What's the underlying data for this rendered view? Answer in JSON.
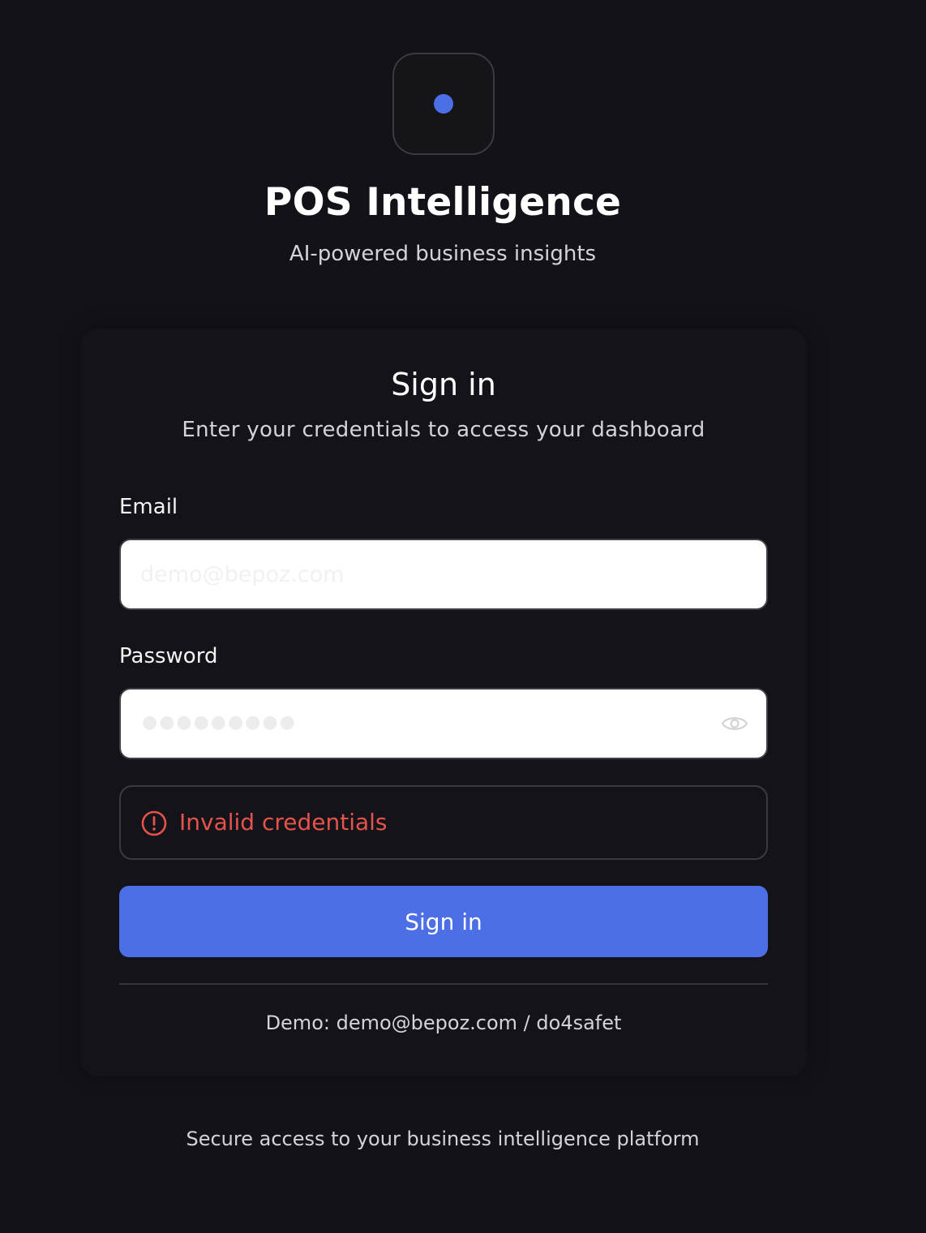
{
  "brand": {
    "title": "POS Intelligence",
    "subtitle": "AI-powered business insights",
    "logo_icon": "dot-logo-icon",
    "accent_color": "#4d6fe6"
  },
  "card": {
    "title": "Sign in",
    "subtitle": "Enter your credentials to access your dashboard",
    "email": {
      "label": "Email",
      "placeholder": "demo@bepoz.com",
      "value": ""
    },
    "password": {
      "label": "Password",
      "placeholder_dots": "●●●●●●●●●",
      "value": "",
      "toggle_icon": "eye-icon"
    },
    "error": {
      "icon": "alert-circle-icon",
      "message": "Invalid credentials",
      "color": "#e5534b"
    },
    "submit_label": "Sign in",
    "demo_hint": "Demo: demo@bepoz.com / do4safet"
  },
  "footer": {
    "text": "Secure access to your business intelligence platform"
  }
}
